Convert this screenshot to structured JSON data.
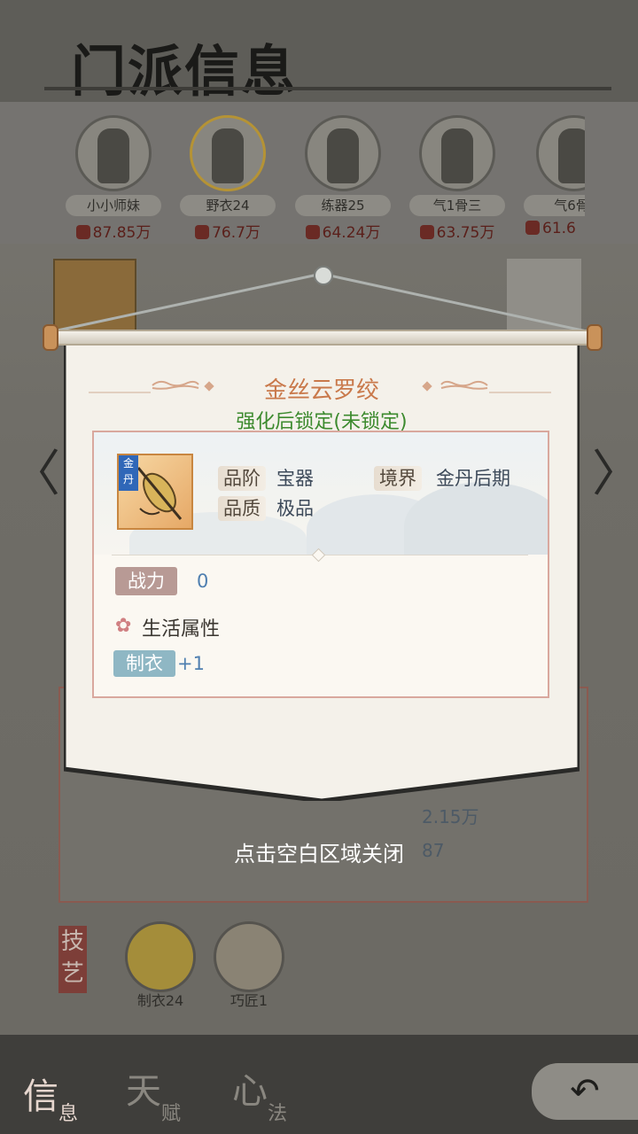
{
  "header": {
    "title": "门派信息"
  },
  "members": [
    {
      "name": "小小师妹",
      "power": "87.85万",
      "active": false
    },
    {
      "name": "野衣24",
      "power": "76.7万",
      "active": true
    },
    {
      "name": "练器25",
      "power": "64.24万",
      "active": false
    },
    {
      "name": "气1骨三",
      "power": "63.75万",
      "active": false
    },
    {
      "name": "气6骨",
      "power": "61.6",
      "active": false
    }
  ],
  "nav": {
    "prev_arrow": "〈",
    "next_arrow": "〉"
  },
  "background_stats": {
    "stat1": "2.15万",
    "stat2": "87"
  },
  "skills": {
    "section_label": "技艺",
    "items": [
      {
        "label": "制衣24"
      },
      {
        "label": "巧匠1"
      }
    ]
  },
  "bottom_tabs": [
    {
      "big": "信",
      "small": "息",
      "active": true
    },
    {
      "big": "天",
      "small": "赋",
      "active": false
    },
    {
      "big": "心",
      "small": "法",
      "active": false
    }
  ],
  "back_button": {
    "label": "↶"
  },
  "popup": {
    "item_name": "金丝云罗绞",
    "lock_status": "强化后锁定(未锁定)",
    "item_tag": "金丹",
    "attributes": [
      {
        "key": "品阶",
        "value": "宝器"
      },
      {
        "key": "境界",
        "value": "金丹后期"
      },
      {
        "key": "品质",
        "value": "极品"
      }
    ],
    "power_label": "战力",
    "power_value": "0",
    "life_section_title": "生活属性",
    "life_attrs": [
      {
        "key": "制衣",
        "value": "+1"
      }
    ],
    "close_hint": "点击空白区域关闭"
  },
  "colors": {
    "title_accent": "#c9794b",
    "lock_status_green": "#3c8a2e",
    "value_blue": "#4f7fb0",
    "border_pink": "#d9a89e"
  }
}
